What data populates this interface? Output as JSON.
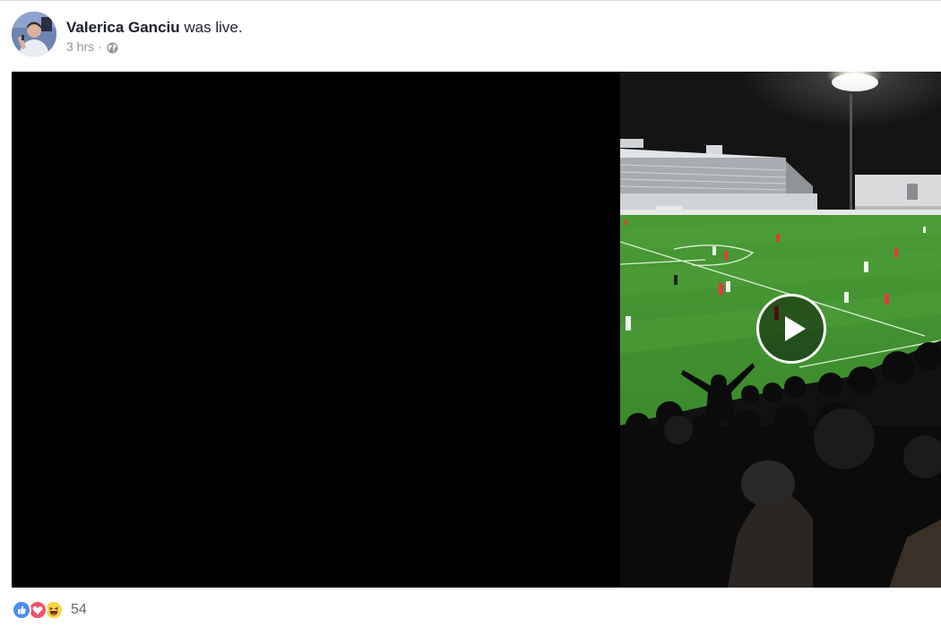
{
  "post": {
    "author": "Valerica Ganciu",
    "action": "was live.",
    "timestamp": "3 hrs",
    "separator": "·",
    "privacy_icon": "globe-icon"
  },
  "video": {
    "state": "paused",
    "play_icon": "play-icon"
  },
  "reactions": {
    "icons": [
      "like-icon",
      "love-icon",
      "haha-icon"
    ],
    "count": "54"
  },
  "colors": {
    "author_text": "#1d2129",
    "meta_text": "#90949c",
    "like": "#4a8cf5",
    "love": "#f25268",
    "haha": "#fdd246",
    "pitch": "#3f8f2f"
  }
}
